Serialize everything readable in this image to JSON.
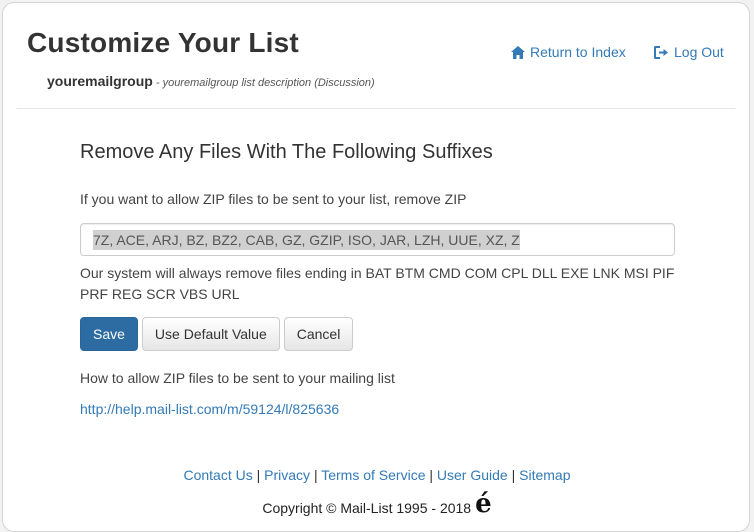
{
  "header": {
    "title": "Customize Your List",
    "group_name": "youremailgroup",
    "group_desc": " - youremailgroup list description (Discussion)",
    "return_label": "Return to Index",
    "logout_label": "Log Out",
    "return_icon": "home-icon",
    "logout_icon": "sign-out-icon"
  },
  "main": {
    "section_title": "Remove Any Files With The Following Suffixes",
    "help_text": "If you want to allow ZIP files to be sent to your list, remove ZIP",
    "suffix_value": "7Z, ACE, ARJ, BZ, BZ2, CAB, GZ, GZIP, ISO, JAR, LZH, UUE, XZ, Z",
    "always_text": "Our system will always remove files ending in BAT BTM CMD COM CPL DLL EXE LNK MSI PIF PRF REG SCR VBS URL",
    "buttons": {
      "save": "Save",
      "default": "Use Default Value",
      "cancel": "Cancel"
    },
    "how_text": "How to allow ZIP files to be sent to your mailing list",
    "help_url": "http://help.mail-list.com/m/59124/l/825636"
  },
  "footer": {
    "links": [
      "Contact Us",
      "Privacy",
      "Terms of Service",
      "User Guide",
      "Sitemap"
    ],
    "separator": " | ",
    "copyright": "Copyright © Mail-List 1995 - 2018",
    "logo_text": "é"
  },
  "colors": {
    "link": "#337ab7",
    "primary": "#2d6ca2"
  }
}
